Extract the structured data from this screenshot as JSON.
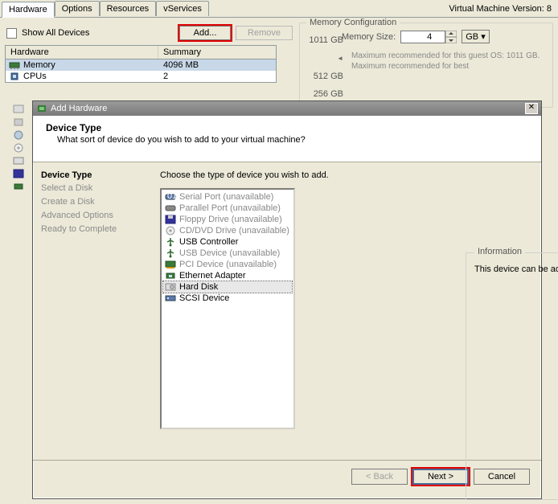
{
  "tabs": {
    "hardware": "Hardware",
    "options": "Options",
    "resources": "Resources",
    "vservices": "vServices"
  },
  "vm_version": "Virtual Machine Version: 8",
  "show_all": "Show All Devices",
  "buttons": {
    "add": "Add...",
    "remove": "Remove"
  },
  "hw_table": {
    "col1": "Hardware",
    "col2": "Summary",
    "rows": [
      {
        "name": "Memory",
        "summary": "4096 MB",
        "icon": "memory-icon"
      },
      {
        "name": "CPUs",
        "summary": "2",
        "icon": "cpu-icon"
      }
    ]
  },
  "memcfg": {
    "title": "Memory Configuration",
    "scale": [
      "1011 GB",
      "512 GB",
      "256 GB"
    ],
    "size_label": "Memory Size:",
    "size_value": "4",
    "unit": "GB",
    "note1": "Maximum recommended for this guest OS: 1011 GB.",
    "note2": "Maximum recommended for best"
  },
  "dialog": {
    "title": "Add Hardware",
    "header": {
      "title": "Device Type",
      "sub": "What sort of device do you wish to add to your virtual machine?"
    },
    "steps_title": "Device Type",
    "steps": [
      "Select a Disk",
      "Create a Disk",
      "Advanced Options",
      "Ready to Complete"
    ],
    "choose": "Choose the type of device you wish to add.",
    "devices": [
      {
        "label": "Serial Port (unavailable)",
        "unavail": true,
        "icon": "serial-icon"
      },
      {
        "label": "Parallel Port (unavailable)",
        "unavail": true,
        "icon": "parallel-icon"
      },
      {
        "label": "Floppy Drive (unavailable)",
        "unavail": true,
        "icon": "floppy-icon"
      },
      {
        "label": "CD/DVD Drive (unavailable)",
        "unavail": true,
        "icon": "cd-icon"
      },
      {
        "label": "USB Controller",
        "unavail": false,
        "icon": "usb-icon"
      },
      {
        "label": "USB Device (unavailable)",
        "unavail": true,
        "icon": "usb-icon"
      },
      {
        "label": "PCI Device (unavailable)",
        "unavail": true,
        "icon": "pci-icon"
      },
      {
        "label": "Ethernet Adapter",
        "unavail": false,
        "icon": "nic-icon"
      },
      {
        "label": "Hard Disk",
        "unavail": false,
        "icon": "disk-icon",
        "selected": true,
        "highlight": true
      },
      {
        "label": "SCSI Device",
        "unavail": false,
        "icon": "scsi-icon"
      }
    ],
    "info_title": "Information",
    "info_text": "This device can be added to this Virtual Machine.",
    "footer": {
      "back": "< Back",
      "next": "Next >",
      "cancel": "Cancel"
    }
  }
}
